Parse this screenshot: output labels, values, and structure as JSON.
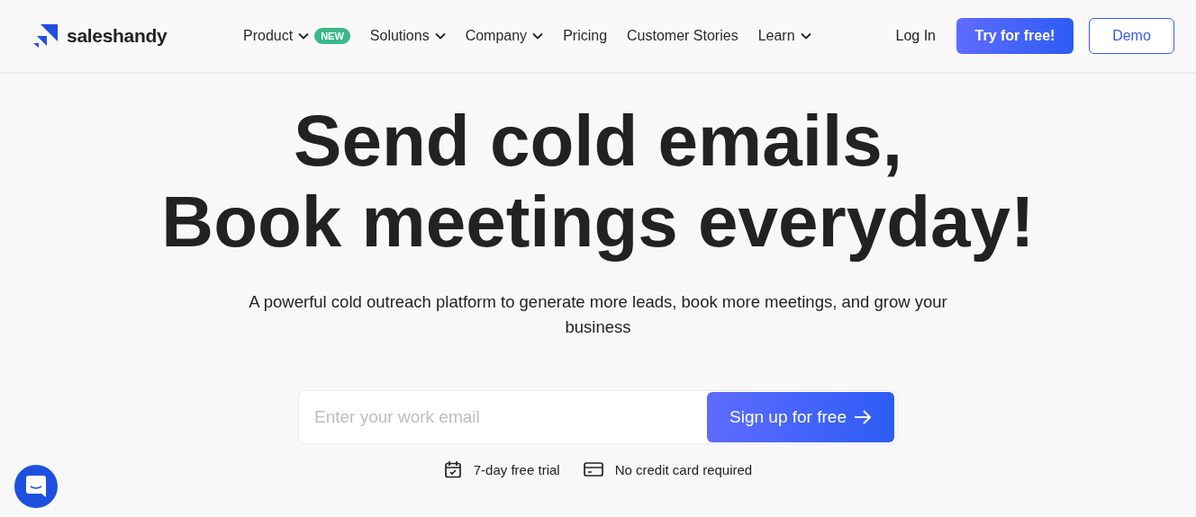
{
  "header": {
    "logo": "saleshandy",
    "nav": [
      {
        "label": "Product",
        "kind": "dropdown",
        "badge": "NEW"
      },
      {
        "label": "Solutions",
        "kind": "dropdown"
      },
      {
        "label": "Company",
        "kind": "dropdown"
      },
      {
        "label": "Pricing",
        "kind": "link"
      },
      {
        "label": "Customer Stories",
        "kind": "link"
      },
      {
        "label": "Learn",
        "kind": "dropdown"
      }
    ],
    "login": "Log In",
    "try_button": "Try for free!",
    "demo_button": "Demo"
  },
  "hero": {
    "title_lines": [
      "Send cold emails,",
      "Book meetings everyday!"
    ],
    "subtitle": "A powerful cold outreach platform to generate more leads, book more meetings, and grow your business",
    "email": {
      "placeholder": "Enter your work email"
    },
    "signup_button": "Sign up for free",
    "perks": [
      {
        "kind": "calendar",
        "text": "7-day free trial"
      },
      {
        "kind": "card",
        "text": "No credit card required"
      }
    ]
  }
}
